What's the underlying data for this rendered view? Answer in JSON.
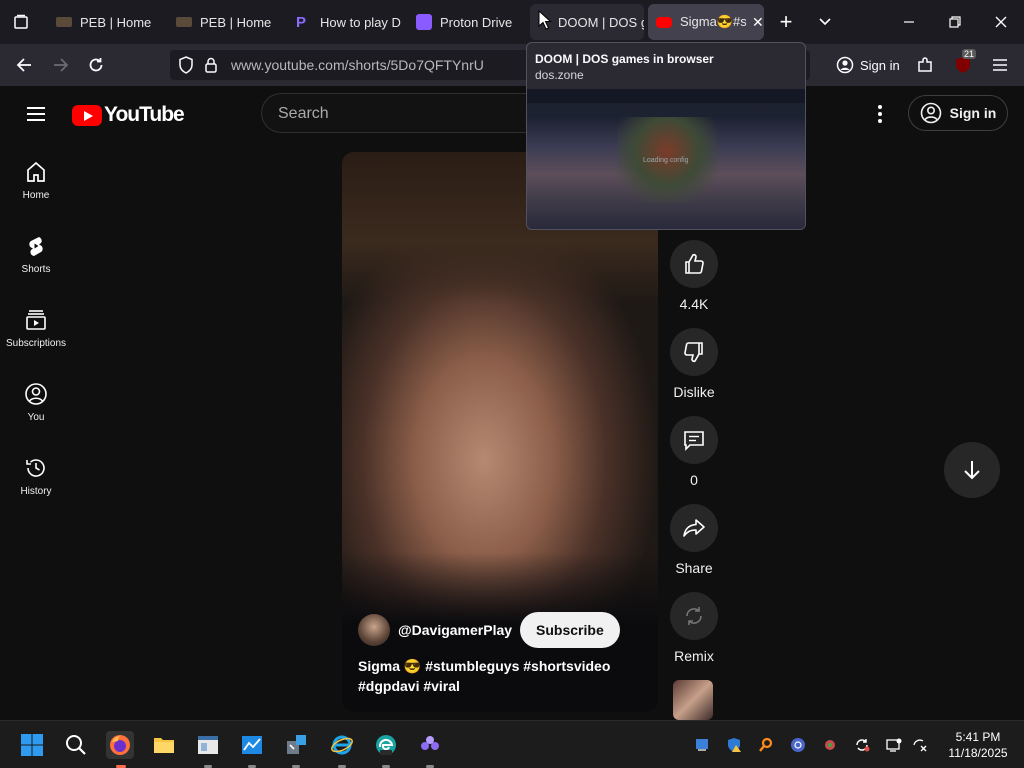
{
  "browser": {
    "tabs": [
      {
        "title": "PEB | Home",
        "active": false
      },
      {
        "title": "PEB | Home",
        "active": false
      },
      {
        "title": "How to play D",
        "active": false
      },
      {
        "title": "Proton Drive",
        "active": false
      },
      {
        "title": "DOOM | DOS g",
        "active": false
      },
      {
        "title": "Sigma😎#s",
        "active": true
      }
    ],
    "url": "www.youtube.com/shorts/5Do7QFTYnrU",
    "sign_in_label": "Sign in",
    "extension_badge": "21",
    "tab_preview": {
      "title": "DOOM | DOS games in browser",
      "domain": "dos.zone",
      "loading_text": "Loading config"
    }
  },
  "youtube": {
    "logo_text": "YouTube",
    "search_placeholder": "Search",
    "sign_in_label": "Sign in",
    "left_nav": [
      {
        "label": "Home",
        "icon": "home-icon"
      },
      {
        "label": "Shorts",
        "icon": "shorts-icon"
      },
      {
        "label": "Subscriptions",
        "icon": "subscriptions-icon"
      },
      {
        "label": "You",
        "icon": "you-icon"
      },
      {
        "label": "History",
        "icon": "history-icon"
      }
    ],
    "short": {
      "channel": "@DavigamerPlay",
      "subscribe_label": "Subscribe",
      "caption_line1": "Sigma 😎 #stumbleguys #shortsvideo",
      "caption_line2": "#dgpdavi #viral"
    },
    "actions": {
      "likes": "4.4K",
      "dislike_label": "Dislike",
      "comments": "0",
      "share_label": "Share",
      "remix_label": "Remix"
    }
  },
  "taskbar": {
    "time": "5:41 PM",
    "date": "11/18/2025"
  },
  "colors": {
    "youtube_red": "#ff0000",
    "browser_tabbar": "#1c1b22",
    "browser_navbar": "#2b2a33",
    "yt_background": "#0f0f0f"
  }
}
